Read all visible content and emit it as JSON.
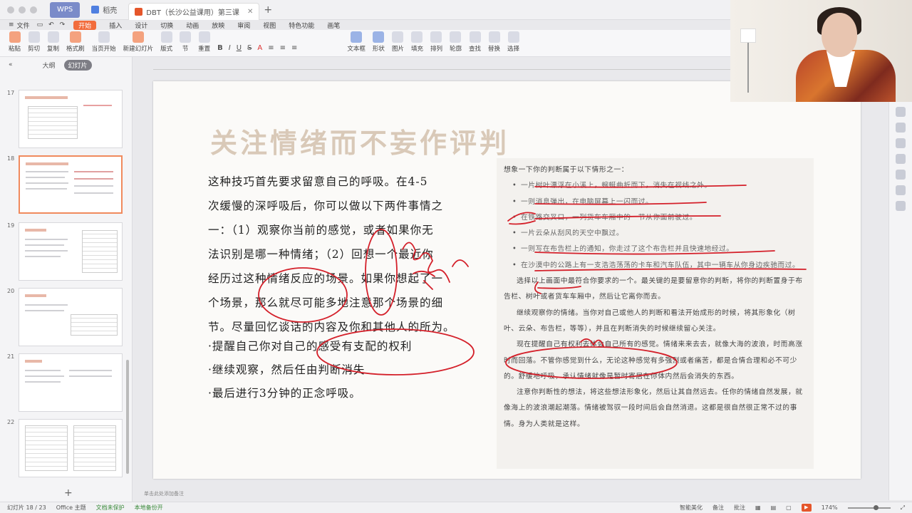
{
  "titlebar": {
    "wps_label": "WPS",
    "shell_tab": "稻壳",
    "doc_tab": "DBT（长沙公益课用）第三课",
    "close": "✕",
    "plus": "+"
  },
  "menu": {
    "file": "文件",
    "items": [
      "开始",
      "插入",
      "设计",
      "切换",
      "动画",
      "放映",
      "审阅",
      "视图",
      "特色功能",
      "画笔"
    ]
  },
  "ribbon": {
    "paste": "粘贴",
    "cut": "剪切",
    "copy": "复制",
    "format_painter": "格式刷",
    "play_from_current": "当页开始",
    "new_slide": "新建幻灯片",
    "layout": "版式",
    "section": "节",
    "reset": "重置",
    "text_box": "文本框",
    "shape": "形状",
    "image": "图片",
    "fill": "填充",
    "arrange": "排列",
    "outline": "轮廓",
    "find": "查找",
    "replace": "替换",
    "select": "选择"
  },
  "left_panel": {
    "outline_tab": "大纲",
    "slides_tab": "幻灯片",
    "slide_numbers": [
      "17",
      "18",
      "19",
      "20",
      "21",
      "22"
    ],
    "add": "+"
  },
  "slide": {
    "title": "关注情绪而不妄作评判",
    "body_lines": [
      "这种技巧首先要求留意自己的呼吸。在4-5",
      "次缓慢的深呼吸后，你可以做以下两件事情之",
      "一：（1）观察你当前的感觉，或者如果你无",
      "法识别是哪一种情绪；（2）回想一个最近你",
      "经历过这种情绪反应的场景。如果你想起了一",
      "个场景，那么就尽可能多地注意那个场景的细",
      "节。尽量回忆谈话的内容及你和其他人的所为。"
    ],
    "bullets": [
      "·提醒自己你对自己的感受有支配的权利",
      "·继续观察，然后任由判断消失",
      "·最后进行3分钟的正念呼吸。"
    ],
    "right_intro": "想象一下你的判断属于以下情形之一：",
    "right_items": [
      "一片树叶漂浮在小溪上，蜿蜒曲折而下，消失在视线之外。",
      "一则消息弹出，在电脑屏幕上一闪而过。",
      "在铁路交叉口，一列货车车厢中的一节从你面前驶过。",
      "一片云朵从刮风的天空中飘过。",
      "一则写在布告栏上的通知，你走过了这个布告栏并且快速地经过。",
      "在沙漠中的公路上有一支浩浩荡荡的卡车和汽车队伍，其中一辆车从你身边疾驰而过。"
    ],
    "right_paras": [
      "选择以上画面中最符合你要求的一个。最关键的是要留意你的判断，将你的判断置身于布告栏、树叶或者货车车厢中，然后让它离你而去。",
      "继续观察你的情绪。当你对自己或他人的判断和看法开始成形的时候，将其形象化（树叶、云朵、布告栏，等等），并且在判断消失的时候继续留心关注。",
      "现在提醒自己有权利去体会自己所有的感觉。情绪来来去去，就像大海的波浪，时而高涨时而回落。不管你感觉到什么，无论这种感觉有多强烈或者痛苦，都是合情合理和必不可少的。舒缓地呼吸，承认情绪就像是暂时寄居在你体内然后会消失的东西。",
      "注意你判断性的想法，将这些想法形象化，然后让其自然远去。任你的情绪自然发展，就像海上的波浪潮起潮落。情绪被驾驭一段时间后会自然消退。这都是很自然很正常不过的事情。身为人类就是这样。"
    ]
  },
  "statusbar": {
    "slide_count": "幻灯片 18 / 23",
    "theme": "Office 主题",
    "protect": "文档未保护",
    "backup": "本地备份开",
    "beautify": "智能美化",
    "notes_toggle": "备注",
    "comments": "批注",
    "zoom": "174%",
    "notes_placeholder": "单击此处添加备注"
  },
  "colors": {
    "accent": "#f26c3c",
    "ink": "#d4202a",
    "title": "#d9c9b8"
  }
}
